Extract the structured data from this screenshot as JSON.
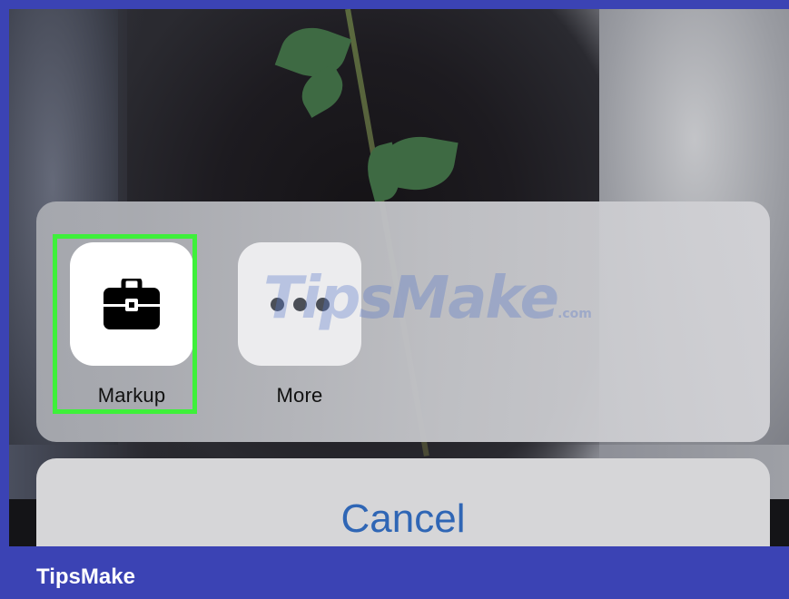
{
  "share_sheet": {
    "actions": [
      {
        "label": "Markup",
        "icon": "toolbox-icon"
      },
      {
        "label": "More",
        "icon": "more-dots-icon"
      }
    ],
    "cancel_label": "Cancel"
  },
  "watermark": {
    "text": "TipsMake",
    "suffix": ".com"
  },
  "footer": {
    "brand": "TipsMake"
  },
  "colors": {
    "highlight": "#3ef03a",
    "cancel_text": "#2f66b5",
    "frame": "#3b43b4"
  }
}
